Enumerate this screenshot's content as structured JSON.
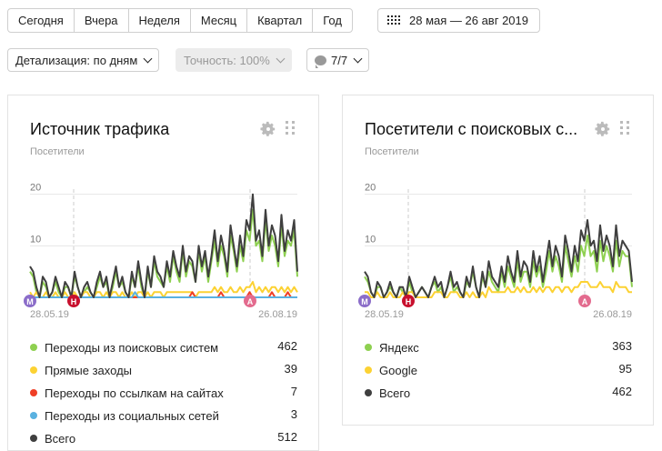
{
  "periods": [
    "Сегодня",
    "Вчера",
    "Неделя",
    "Месяц",
    "Квартал",
    "Год"
  ],
  "date_range": "28 мая — 26 авг 2019",
  "detail_label": "Детализация: по дням",
  "accuracy_label": "Точность: 100%",
  "annotations_label": "7/7",
  "colors": {
    "green": "#8ed050",
    "yellow": "#fcd233",
    "red": "#ef3f26",
    "blue": "#5ab1e0",
    "dark": "#3f3f3f",
    "marker_m": "#8b6dc9",
    "marker_h": "#c8102e",
    "marker_a": "#e36b8e"
  },
  "cards": [
    {
      "title": "Источник трафика",
      "subtitle": "Посетители",
      "y_ticks": [
        "20",
        "10"
      ],
      "x_labels": [
        "28.05.19",
        "26.08.19"
      ],
      "markers": [
        "М",
        "Н",
        "А"
      ],
      "legend": [
        {
          "label": "Переходы из поисковых систем",
          "value": "462",
          "color": "green"
        },
        {
          "label": "Прямые заходы",
          "value": "39",
          "color": "yellow"
        },
        {
          "label": "Переходы по ссылкам на сайтах",
          "value": "7",
          "color": "red"
        },
        {
          "label": "Переходы из социальных сетей",
          "value": "3",
          "color": "blue"
        },
        {
          "label": "Всего",
          "value": "512",
          "color": "dark"
        }
      ],
      "chart_data": {
        "type": "line",
        "x_start": "28.05.19",
        "x_end": "26.08.19",
        "ylim": [
          0,
          21
        ],
        "y_ticks": [
          10,
          20
        ],
        "series": [
          {
            "name": "Всего",
            "color": "dark",
            "values": [
              6,
              5,
              2,
              0,
              4,
              3,
              0,
              1,
              4,
              2,
              0,
              3,
              2,
              0,
              5,
              2,
              0,
              2,
              3,
              1,
              0,
              3,
              5,
              2,
              4,
              0,
              3,
              6,
              2,
              4,
              1,
              0,
              5,
              2,
              7,
              3,
              0,
              6,
              2,
              8,
              5,
              4,
              2,
              7,
              4,
              9,
              6,
              4,
              10,
              5,
              8,
              7,
              3,
              10,
              6,
              9,
              4,
              8,
              13,
              7,
              12,
              9,
              5,
              14,
              10,
              6,
              12,
              8,
              15,
              13,
              20,
              11,
              13,
              8,
              17,
              10,
              14,
              12,
              7,
              16,
              9,
              13,
              11,
              15,
              5
            ]
          },
          {
            "name": "Переходы из поисковых систем",
            "color": "green",
            "values": [
              5,
              4,
              1,
              0,
              3,
              2,
              0,
              1,
              3,
              1,
              0,
              2,
              2,
              0,
              4,
              2,
              0,
              1,
              2,
              1,
              0,
              2,
              4,
              2,
              3,
              0,
              2,
              5,
              2,
              3,
              1,
              0,
              4,
              2,
              6,
              2,
              0,
              5,
              2,
              7,
              4,
              3,
              2,
              6,
              3,
              8,
              5,
              3,
              9,
              4,
              7,
              6,
              3,
              9,
              5,
              8,
              3,
              7,
              11,
              6,
              10,
              8,
              4,
              12,
              9,
              5,
              10,
              7,
              13,
              11,
              17,
              10,
              11,
              7,
              15,
              9,
              12,
              10,
              6,
              14,
              8,
              11,
              10,
              13,
              4
            ]
          },
          {
            "name": "Прямые заходы",
            "color": "yellow",
            "values": [
              1,
              0,
              1,
              0,
              0,
              1,
              0,
              0,
              1,
              0,
              0,
              1,
              0,
              0,
              1,
              0,
              0,
              1,
              1,
              0,
              0,
              1,
              1,
              0,
              1,
              0,
              1,
              1,
              0,
              1,
              0,
              0,
              1,
              0,
              1,
              1,
              0,
              1,
              0,
              1,
              1,
              1,
              0,
              1,
              1,
              1,
              1,
              1,
              1,
              1,
              1,
              1,
              0,
              1,
              1,
              1,
              1,
              1,
              2,
              1,
              2,
              1,
              1,
              2,
              1,
              1,
              2,
              1,
              2,
              2,
              3,
              1,
              2,
              1,
              2,
              1,
              2,
              2,
              1,
              2,
              1,
              2,
              1,
              2,
              1
            ]
          },
          {
            "name": "Переходы по ссылкам на сайтах",
            "color": "red",
            "values": [
              0,
              0,
              0,
              0,
              0,
              0,
              0,
              0,
              0,
              0,
              0,
              0,
              0,
              0,
              0,
              0,
              0,
              0,
              0,
              0,
              0,
              0,
              0,
              0,
              0,
              0,
              0,
              0,
              0,
              0,
              0,
              0,
              0,
              0,
              0,
              0,
              0,
              0,
              0,
              0,
              0,
              0,
              0,
              0,
              0,
              0,
              0,
              0,
              0,
              0,
              0,
              1,
              0,
              0,
              0,
              0,
              0,
              0,
              0,
              0,
              1,
              0,
              0,
              0,
              0,
              0,
              0,
              0,
              0,
              1,
              0,
              0,
              0,
              0,
              0,
              0,
              1,
              0,
              0,
              0,
              0,
              1,
              0,
              0,
              0
            ]
          },
          {
            "name": "Переходы из социальных сетей",
            "color": "blue",
            "values": [
              0,
              0,
              0,
              0,
              0,
              0,
              0,
              0,
              0,
              0,
              0,
              0,
              0,
              0,
              0,
              0,
              0,
              0,
              0,
              0,
              0,
              0,
              0,
              0,
              0,
              0,
              0,
              0,
              0,
              0,
              0,
              0,
              0,
              1,
              0,
              0,
              0,
              0,
              0,
              0,
              0,
              0,
              0,
              0,
              0,
              0,
              0,
              0,
              0,
              0,
              0,
              0,
              0,
              0,
              0,
              0,
              0,
              0,
              0,
              0,
              0,
              0,
              0,
              0,
              0,
              0,
              0,
              0,
              0,
              0,
              0,
              0,
              0,
              0,
              0,
              0,
              0,
              0,
              0,
              0,
              0,
              0,
              0,
              0,
              0
            ]
          }
        ]
      }
    },
    {
      "title": "Посетители с поисковых с...",
      "subtitle": "Посетители",
      "y_ticks": [
        "20",
        "10"
      ],
      "x_labels": [
        "28.05.19",
        "26.08.19"
      ],
      "markers": [
        "М",
        "Н",
        "А"
      ],
      "legend": [
        {
          "label": "Яндекс",
          "value": "363",
          "color": "green"
        },
        {
          "label": "Google",
          "value": "95",
          "color": "yellow"
        },
        {
          "label": "Всего",
          "value": "462",
          "color": "dark"
        }
      ],
      "chart_data": {
        "type": "line",
        "x_start": "28.05.19",
        "x_end": "26.08.19",
        "ylim": [
          0,
          21
        ],
        "y_ticks": [
          10,
          20
        ],
        "series": [
          {
            "name": "Всего",
            "color": "dark",
            "values": [
              5,
              4,
              1,
              0,
              3,
              2,
              0,
              1,
              3,
              1,
              0,
              2,
              2,
              0,
              4,
              2,
              0,
              1,
              2,
              1,
              0,
              2,
              4,
              2,
              3,
              0,
              2,
              5,
              2,
              3,
              1,
              0,
              4,
              2,
              6,
              2,
              0,
              5,
              2,
              7,
              4,
              3,
              2,
              6,
              3,
              8,
              5,
              3,
              9,
              4,
              7,
              6,
              3,
              9,
              5,
              8,
              3,
              7,
              11,
              6,
              10,
              8,
              4,
              12,
              9,
              5,
              10,
              7,
              13,
              11,
              15,
              10,
              11,
              7,
              14,
              9,
              12,
              10,
              6,
              14,
              8,
              11,
              10,
              9,
              3
            ]
          },
          {
            "name": "Яндекс",
            "color": "green",
            "values": [
              4,
              3,
              1,
              0,
              2,
              2,
              0,
              1,
              2,
              1,
              0,
              2,
              1,
              0,
              3,
              1,
              0,
              1,
              2,
              1,
              0,
              2,
              3,
              1,
              2,
              0,
              2,
              4,
              1,
              2,
              1,
              0,
              3,
              2,
              5,
              2,
              0,
              4,
              2,
              5,
              3,
              2,
              1,
              5,
              2,
              6,
              4,
              2,
              7,
              3,
              5,
              5,
              2,
              7,
              4,
              6,
              2,
              5,
              9,
              5,
              8,
              6,
              3,
              10,
              7,
              4,
              8,
              5,
              10,
              8,
              12,
              8,
              9,
              5,
              11,
              7,
              10,
              8,
              5,
              11,
              6,
              9,
              8,
              8,
              2
            ]
          },
          {
            "name": "Google",
            "color": "yellow",
            "values": [
              1,
              1,
              0,
              0,
              1,
              0,
              0,
              0,
              1,
              0,
              0,
              0,
              1,
              0,
              1,
              1,
              0,
              0,
              0,
              0,
              0,
              0,
              1,
              1,
              1,
              0,
              0,
              1,
              1,
              1,
              0,
              0,
              1,
              0,
              1,
              0,
              0,
              1,
              0,
              2,
              1,
              1,
              1,
              1,
              1,
              2,
              1,
              1,
              2,
              1,
              2,
              1,
              1,
              2,
              1,
              2,
              1,
              2,
              2,
              1,
              2,
              2,
              1,
              2,
              2,
              1,
              2,
              2,
              3,
              3,
              3,
              2,
              2,
              2,
              3,
              2,
              2,
              2,
              1,
              3,
              2,
              2,
              2,
              1,
              1
            ]
          }
        ]
      }
    }
  ]
}
